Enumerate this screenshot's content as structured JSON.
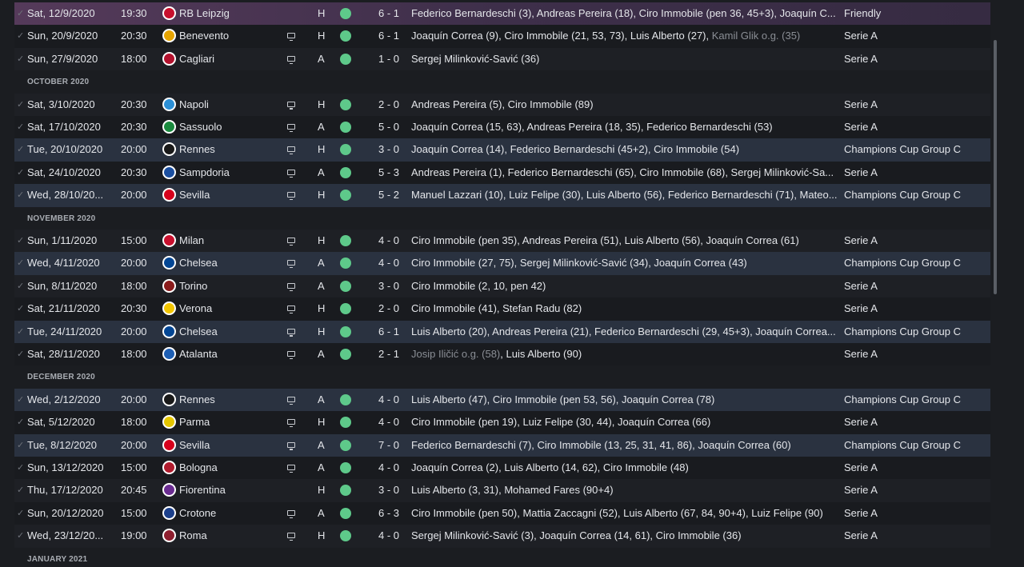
{
  "colors": {
    "result_win": "#5ec98a",
    "highlight_row": "#2a3240",
    "first_row": "#553a5a"
  },
  "fixtures": [
    {
      "type": "match",
      "date": "Sat, 12/9/2020",
      "time": "19:30",
      "opponent": "RB Leipzig",
      "crest": "rb-leipzig-crest",
      "crest_color": "#c8102e",
      "tv": false,
      "venue": "H",
      "score_home": "6",
      "score_away": "1",
      "scorers": "Federico Bernardeschi (3), Andreas Pereira (18), Ciro Immobile (pen 36, 45+3), Joaquín C...",
      "og": "",
      "competition": "Friendly",
      "style": "first"
    },
    {
      "type": "match",
      "date": "Sun, 20/9/2020",
      "time": "20:30",
      "opponent": "Benevento",
      "crest": "benevento-crest",
      "crest_color": "#e7a400",
      "tv": true,
      "venue": "H",
      "score_home": "6",
      "score_away": "1",
      "scorers": "Joaquín Correa (9), Ciro Immobile (21, 53, 73), Luis Alberto (27), ",
      "og": "Kamil Glik o.g. (35)",
      "competition": "Serie A",
      "style": "even"
    },
    {
      "type": "match",
      "date": "Sun, 27/9/2020",
      "time": "18:00",
      "opponent": "Cagliari",
      "crest": "cagliari-crest",
      "crest_color": "#b3122e",
      "tv": true,
      "venue": "A",
      "score_home": "1",
      "score_away": "0",
      "scorers": "Sergej Milinković-Savić (36)",
      "og": "",
      "competition": "Serie A",
      "style": "odd"
    },
    {
      "type": "month",
      "label": "OCTOBER 2020"
    },
    {
      "type": "match",
      "date": "Sat, 3/10/2020",
      "time": "20:30",
      "opponent": "Napoli",
      "crest": "napoli-crest",
      "crest_color": "#2b8fd6",
      "tv": true,
      "venue": "H",
      "score_home": "2",
      "score_away": "0",
      "scorers": "Andreas Pereira (5), Ciro Immobile (89)",
      "og": "",
      "competition": "Serie A",
      "style": "odd"
    },
    {
      "type": "match",
      "date": "Sat, 17/10/2020",
      "time": "20:30",
      "opponent": "Sassuolo",
      "crest": "sassuolo-crest",
      "crest_color": "#1a8a3e",
      "tv": true,
      "venue": "A",
      "score_home": "5",
      "score_away": "0",
      "scorers": "Joaquín Correa (15, 63), Andreas Pereira (18, 35), Federico Bernardeschi (53)",
      "og": "",
      "competition": "Serie A",
      "style": "even"
    },
    {
      "type": "match",
      "date": "Tue, 20/10/2020",
      "time": "20:00",
      "opponent": "Rennes",
      "crest": "rennes-crest",
      "crest_color": "#1a1a1a",
      "tv": true,
      "venue": "H",
      "score_home": "3",
      "score_away": "0",
      "scorers": "Joaquín Correa (14), Federico Bernardeschi (45+2), Ciro Immobile (54)",
      "og": "",
      "competition": "Champions Cup Group C",
      "style": "hl"
    },
    {
      "type": "match",
      "date": "Sat, 24/10/2020",
      "time": "20:30",
      "opponent": "Sampdoria",
      "crest": "sampdoria-crest",
      "crest_color": "#1b4fa0",
      "tv": true,
      "venue": "A",
      "score_home": "5",
      "score_away": "3",
      "scorers": "Andreas Pereira (1), Federico Bernardeschi (65), Ciro Immobile (68), Sergej Milinković-Sa...",
      "og": "",
      "competition": "Serie A",
      "style": "even"
    },
    {
      "type": "match",
      "date": "Wed, 28/10/20...",
      "time": "20:00",
      "opponent": "Sevilla",
      "crest": "sevilla-crest",
      "crest_color": "#d6001c",
      "tv": true,
      "venue": "H",
      "score_home": "5",
      "score_away": "2",
      "scorers": "Manuel Lazzari (10), Luiz Felipe (30), Luis Alberto (56), Federico Bernardeschi (71), Mateo...",
      "og": "",
      "competition": "Champions Cup Group C",
      "style": "hl"
    },
    {
      "type": "month",
      "label": "NOVEMBER 2020"
    },
    {
      "type": "match",
      "date": "Sun, 1/11/2020",
      "time": "15:00",
      "opponent": "Milan",
      "crest": "milan-crest",
      "crest_color": "#c8102e",
      "tv": true,
      "venue": "H",
      "score_home": "4",
      "score_away": "0",
      "scorers": "Ciro Immobile (pen 35), Andreas Pereira (51), Luis Alberto (56), Joaquín Correa (61)",
      "og": "",
      "competition": "Serie A",
      "style": "odd"
    },
    {
      "type": "match",
      "date": "Wed, 4/11/2020",
      "time": "20:00",
      "opponent": "Chelsea",
      "crest": "chelsea-crest",
      "crest_color": "#034694",
      "tv": true,
      "venue": "A",
      "score_home": "4",
      "score_away": "0",
      "scorers": "Ciro Immobile (27, 75), Sergej Milinković-Savić (34), Joaquín Correa (43)",
      "og": "",
      "competition": "Champions Cup Group C",
      "style": "hl"
    },
    {
      "type": "match",
      "date": "Sun, 8/11/2020",
      "time": "18:00",
      "opponent": "Torino",
      "crest": "torino-crest",
      "crest_color": "#8a1c1c",
      "tv": true,
      "venue": "A",
      "score_home": "3",
      "score_away": "0",
      "scorers": "Ciro Immobile (2, 10, pen 42)",
      "og": "",
      "competition": "Serie A",
      "style": "odd"
    },
    {
      "type": "match",
      "date": "Sat, 21/11/2020",
      "time": "20:30",
      "opponent": "Verona",
      "crest": "verona-crest",
      "crest_color": "#f2c500",
      "tv": true,
      "venue": "H",
      "score_home": "2",
      "score_away": "0",
      "scorers": "Ciro Immobile (41), Stefan Radu (82)",
      "og": "",
      "competition": "Serie A",
      "style": "even"
    },
    {
      "type": "match",
      "date": "Tue, 24/11/2020",
      "time": "20:00",
      "opponent": "Chelsea",
      "crest": "chelsea-crest",
      "crest_color": "#034694",
      "tv": true,
      "venue": "H",
      "score_home": "6",
      "score_away": "1",
      "scorers": "Luis Alberto (20), Andreas Pereira (21), Federico Bernardeschi (29, 45+3), Joaquín Correa...",
      "og": "",
      "competition": "Champions Cup Group C",
      "style": "hl"
    },
    {
      "type": "match",
      "date": "Sat, 28/11/2020",
      "time": "18:00",
      "opponent": "Atalanta",
      "crest": "atalanta-crest",
      "crest_color": "#1e5fb4",
      "tv": true,
      "venue": "A",
      "score_home": "2",
      "score_away": "1",
      "scorers": ", Luis Alberto (90)",
      "og": "Josip Iličić o.g. (58)",
      "og_first": true,
      "competition": "Serie A",
      "style": "even"
    },
    {
      "type": "month",
      "label": "DECEMBER 2020"
    },
    {
      "type": "match",
      "date": "Wed, 2/12/2020",
      "time": "20:00",
      "opponent": "Rennes",
      "crest": "rennes-crest",
      "crest_color": "#1a1a1a",
      "tv": true,
      "venue": "A",
      "score_home": "4",
      "score_away": "0",
      "scorers": "Luis Alberto (47), Ciro Immobile (pen 53, 56), Joaquín Correa (78)",
      "og": "",
      "competition": "Champions Cup Group C",
      "style": "hl"
    },
    {
      "type": "match",
      "date": "Sat, 5/12/2020",
      "time": "18:00",
      "opponent": "Parma",
      "crest": "parma-crest",
      "crest_color": "#e5c700",
      "tv": true,
      "venue": "H",
      "score_home": "4",
      "score_away": "0",
      "scorers": "Ciro Immobile (pen 19), Luiz Felipe (30, 44), Joaquín Correa (66)",
      "og": "",
      "competition": "Serie A",
      "style": "even"
    },
    {
      "type": "match",
      "date": "Tue, 8/12/2020",
      "time": "20:00",
      "opponent": "Sevilla",
      "crest": "sevilla-crest",
      "crest_color": "#d6001c",
      "tv": true,
      "venue": "A",
      "score_home": "7",
      "score_away": "0",
      "scorers": "Federico Bernardeschi (7), Ciro Immobile (13, 25, 31, 41, 86), Joaquín Correa (60)",
      "og": "",
      "competition": "Champions Cup Group C",
      "style": "hl"
    },
    {
      "type": "match",
      "date": "Sun, 13/12/2020",
      "time": "15:00",
      "opponent": "Bologna",
      "crest": "bologna-crest",
      "crest_color": "#b01c2e",
      "tv": true,
      "venue": "A",
      "score_home": "4",
      "score_away": "0",
      "scorers": "Joaquín Correa (2), Luis Alberto (14, 62), Ciro Immobile (48)",
      "og": "",
      "competition": "Serie A",
      "style": "even"
    },
    {
      "type": "match",
      "date": "Thu, 17/12/2020",
      "time": "20:45",
      "opponent": "Fiorentina",
      "crest": "fiorentina-crest",
      "crest_color": "#6a2c91",
      "tv": false,
      "venue": "H",
      "score_home": "3",
      "score_away": "0",
      "scorers": "Luis Alberto (3, 31), Mohamed Fares (90+4)",
      "og": "",
      "competition": "Serie A",
      "style": "odd"
    },
    {
      "type": "match",
      "date": "Sun, 20/12/2020",
      "time": "15:00",
      "opponent": "Crotone",
      "crest": "crotone-crest",
      "crest_color": "#1b3f8b",
      "tv": true,
      "venue": "A",
      "score_home": "6",
      "score_away": "3",
      "scorers": "Ciro Immobile (pen 50), Mattia Zaccagni (52), Luis Alberto (67, 84, 90+4), Luiz Felipe (90)",
      "og": "",
      "competition": "Serie A",
      "style": "even"
    },
    {
      "type": "match",
      "date": "Wed, 23/12/20...",
      "time": "19:00",
      "opponent": "Roma",
      "crest": "roma-crest",
      "crest_color": "#8e1f2f",
      "tv": true,
      "venue": "H",
      "score_home": "4",
      "score_away": "0",
      "scorers": "Sergej Milinković-Savić (3), Joaquín Correa (14, 61), Ciro Immobile (36)",
      "og": "",
      "competition": "Serie A",
      "style": "odd"
    },
    {
      "type": "month",
      "label": "JANUARY 2021"
    }
  ]
}
